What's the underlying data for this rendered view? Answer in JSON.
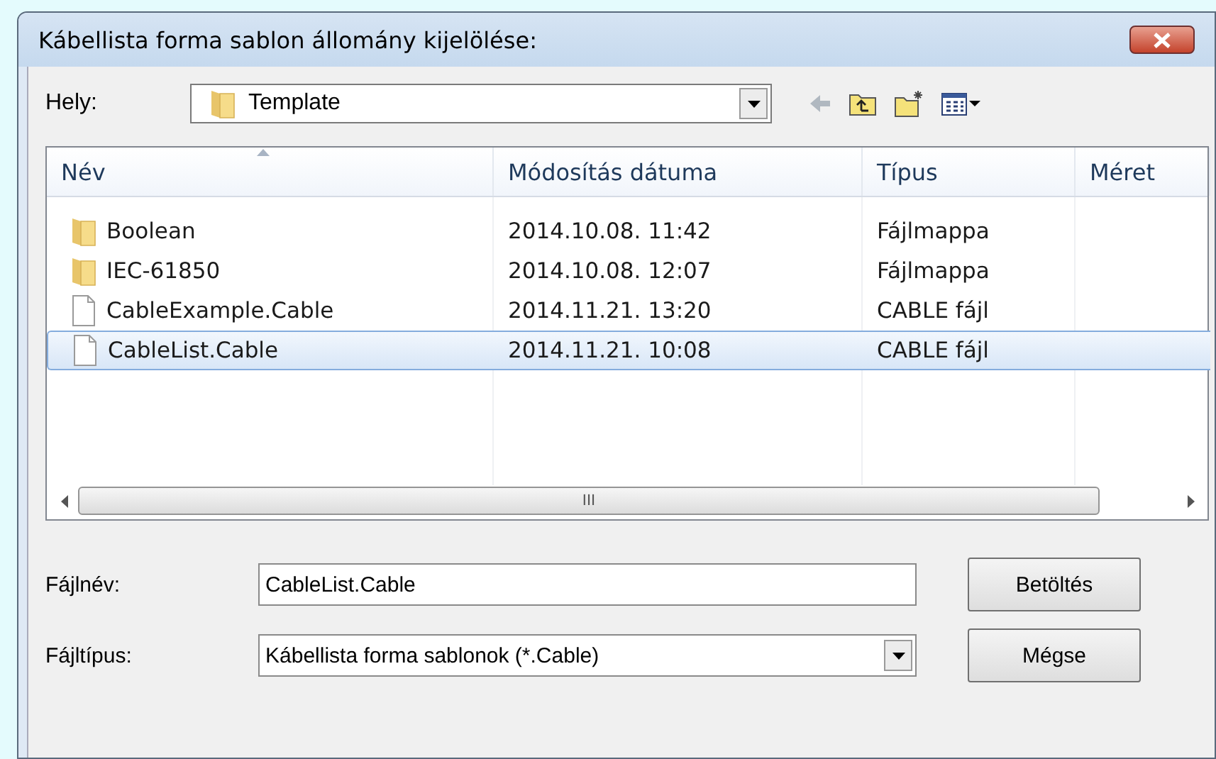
{
  "window": {
    "title": "Kábellista forma sablon állomány kijelölése:"
  },
  "location": {
    "label": "Hely:",
    "value": "Template"
  },
  "columns": [
    {
      "label": "Név",
      "sorted": true
    },
    {
      "label": "Módosítás dátuma",
      "sorted": false
    },
    {
      "label": "Típus",
      "sorted": false
    },
    {
      "label": "Méret",
      "sorted": false
    }
  ],
  "rows": [
    {
      "kind": "folder",
      "name": "Boolean",
      "date": "2014.10.08. 11:42",
      "type": "Fájlmappa",
      "selected": false
    },
    {
      "kind": "folder",
      "name": "IEC-61850",
      "date": "2014.10.08. 12:07",
      "type": "Fájlmappa",
      "selected": false
    },
    {
      "kind": "file",
      "name": "CableExample.Cable",
      "date": "2014.11.21. 13:20",
      "type": "CABLE fájl",
      "selected": false
    },
    {
      "kind": "file",
      "name": "CableList.Cable",
      "date": "2014.11.21. 10:08",
      "type": "CABLE fájl",
      "selected": true
    }
  ],
  "scrollbar_grip": "III",
  "filename": {
    "label": "Fájlnév:",
    "value": "CableList.Cable"
  },
  "filetype": {
    "label": "Fájltípus:",
    "value": "Kábellista forma sablonok (*.Cable)"
  },
  "buttons": [
    {
      "label": "Betöltés"
    },
    {
      "label": "Mégse"
    }
  ]
}
